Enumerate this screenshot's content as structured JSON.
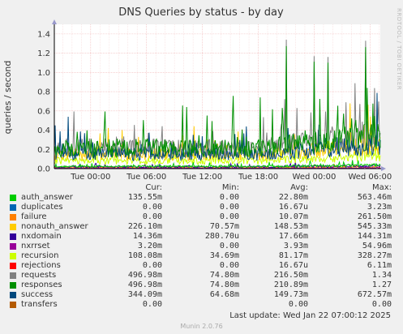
{
  "chart_data": {
    "type": "line",
    "title": "DNS Queries by status - by day",
    "ylabel": "queries / second",
    "xlabel": "",
    "ylim": [
      0,
      1.5
    ],
    "y_ticks": [
      "0.0",
      "0.2",
      "0.4",
      "0.6",
      "0.8",
      "1.0",
      "1.2",
      "1.4"
    ],
    "x_ticks": [
      "Tue 00:00",
      "Tue 06:00",
      "Tue 12:00",
      "Tue 18:00",
      "Wed 00:00",
      "Wed 06:00"
    ],
    "grid": true,
    "legend_position": "bottom",
    "spikes": [
      {
        "x": "Tue 21:00",
        "value": 1.34
      },
      {
        "x": "Wed 00:00",
        "value": 1.17
      },
      {
        "x": "Wed 01:30",
        "value": 1.16
      },
      {
        "x": "Wed 05:30",
        "value": 1.33
      }
    ],
    "series": [
      {
        "name": "auth_answer",
        "color": "#00cc00",
        "cur": "135.55m",
        "min": "0.00",
        "avg": "22.80m",
        "max": "563.46m"
      },
      {
        "name": "duplicates",
        "color": "#0066b3",
        "cur": "0.00",
        "min": "0.00",
        "avg": "16.67u",
        "max": "3.23m"
      },
      {
        "name": "failure",
        "color": "#ff8000",
        "cur": "0.00",
        "min": "0.00",
        "avg": "10.07m",
        "max": "261.50m"
      },
      {
        "name": "nonauth_answer",
        "color": "#ffcc00",
        "cur": "226.10m",
        "min": "70.57m",
        "avg": "148.53m",
        "max": "545.33m"
      },
      {
        "name": "nxdomain",
        "color": "#330099",
        "cur": "14.36m",
        "min": "280.70u",
        "avg": "17.66m",
        "max": "144.31m"
      },
      {
        "name": "nxrrset",
        "color": "#990099",
        "cur": "3.20m",
        "min": "0.00",
        "avg": "3.93m",
        "max": "54.96m"
      },
      {
        "name": "recursion",
        "color": "#ccff00",
        "cur": "108.08m",
        "min": "34.69m",
        "avg": "81.17m",
        "max": "328.27m"
      },
      {
        "name": "rejections",
        "color": "#ff0000",
        "cur": "0.00",
        "min": "0.00",
        "avg": "16.67u",
        "max": "6.11m"
      },
      {
        "name": "requests",
        "color": "#808080",
        "cur": "496.98m",
        "min": "74.80m",
        "avg": "216.50m",
        "max": "1.34"
      },
      {
        "name": "responses",
        "color": "#008f00",
        "cur": "496.98m",
        "min": "74.80m",
        "avg": "210.89m",
        "max": "1.27"
      },
      {
        "name": "success",
        "color": "#00487d",
        "cur": "344.09m",
        "min": "64.68m",
        "avg": "149.73m",
        "max": "672.57m"
      },
      {
        "name": "transfers",
        "color": "#b35a00",
        "cur": "0.00",
        "min": "",
        "avg": "0.00",
        "max": "0.00"
      }
    ]
  },
  "legend_headers": {
    "cur": "Cur:",
    "min": "Min:",
    "avg": "Avg:",
    "max": "Max:"
  },
  "last_update": "Last update: Wed Jan 22 07:00:12 2025",
  "footer": "Munin 2.0.76",
  "watermark": "RRDTOOL / TOBI OETIKER"
}
